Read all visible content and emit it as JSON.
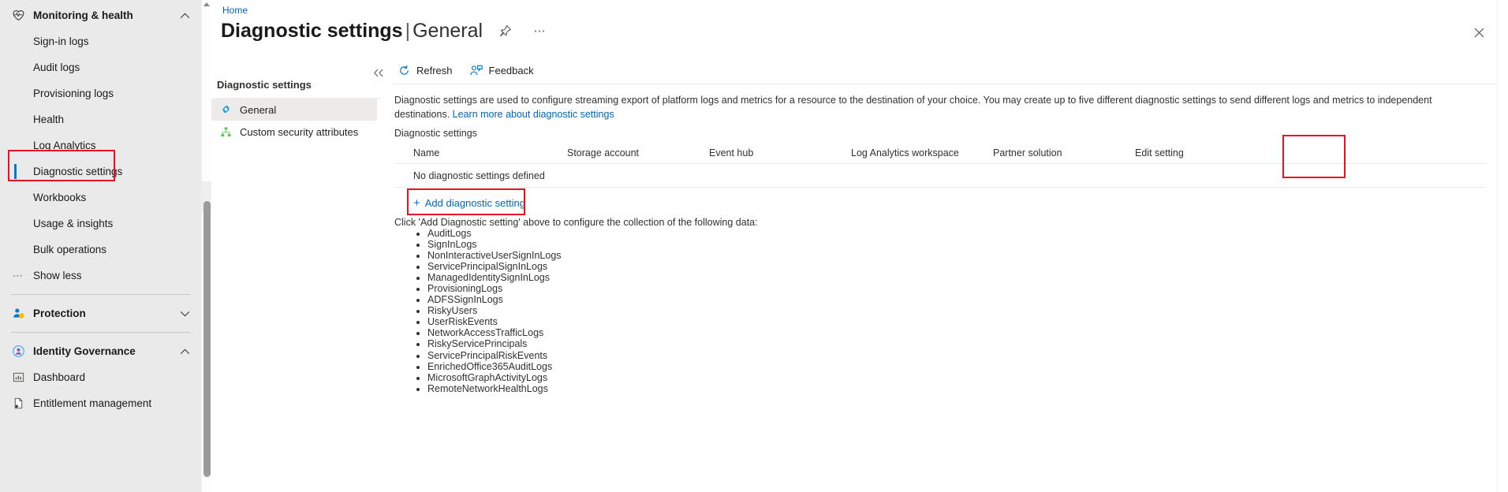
{
  "portal_nav": {
    "groups": [
      {
        "label": "Monitoring & health",
        "icon": "heart-pulse-icon",
        "chevron": "chevron-up-icon",
        "items": [
          {
            "label": "Sign-in logs",
            "icon": ""
          },
          {
            "label": "Audit logs",
            "icon": ""
          },
          {
            "label": "Provisioning logs",
            "icon": ""
          },
          {
            "label": "Health",
            "icon": ""
          },
          {
            "label": "Log Analytics",
            "icon": ""
          },
          {
            "label": "Diagnostic settings",
            "icon": "",
            "selected": true,
            "highlighted": true
          },
          {
            "label": "Workbooks",
            "icon": ""
          },
          {
            "label": "Usage & insights",
            "icon": ""
          },
          {
            "label": "Bulk operations",
            "icon": ""
          },
          {
            "label": "Show less",
            "icon": "ellipsis-icon"
          }
        ]
      },
      {
        "label": "Protection",
        "icon": "shield-person-icon",
        "chevron": "chevron-down-icon",
        "items": []
      },
      {
        "label": "Identity Governance",
        "icon": "identity-governance-icon",
        "chevron": "chevron-up-icon",
        "items": [
          {
            "label": "Dashboard",
            "icon": "dashboard-icon"
          },
          {
            "label": "Entitlement management",
            "icon": "document-icon"
          }
        ]
      }
    ]
  },
  "blade": {
    "breadcrumb": "Home",
    "title": "Diagnostic settings",
    "title_separator": "|",
    "title_sub": "General",
    "pin_icon": "pin-icon",
    "more_icon": "ellipsis-icon",
    "close_icon": "close-icon",
    "collapse_icon": "chevron-double-left-icon",
    "menu": {
      "title": "Diagnostic settings",
      "items": [
        {
          "label": "General",
          "icon": "gear-icon",
          "active": true
        },
        {
          "label": "Custom security attributes",
          "icon": "hierarchy-icon",
          "active": false
        }
      ]
    },
    "toolbar": {
      "refresh_label": "Refresh",
      "refresh_icon": "refresh-icon",
      "feedback_label": "Feedback",
      "feedback_icon": "feedback-person-icon"
    },
    "description": {
      "text": "Diagnostic settings are used to configure streaming export of platform logs and metrics for a resource to the destination of your choice. You may create up to five different diagnostic settings to send different logs and metrics to independent destinations.",
      "link_label": "Learn more about diagnostic settings"
    },
    "section_label": "Diagnostic settings",
    "table": {
      "columns": [
        "Name",
        "Storage account",
        "Event hub",
        "Log Analytics workspace",
        "Partner solution",
        "Edit setting"
      ],
      "empty_message": "No diagnostic settings defined"
    },
    "add_button": {
      "plus": "+",
      "label": "Add diagnostic setting"
    },
    "hint": "Click 'Add Diagnostic setting' above to configure the collection of the following data:",
    "log_categories": [
      "AuditLogs",
      "SignInLogs",
      "NonInteractiveUserSignInLogs",
      "ServicePrincipalSignInLogs",
      "ManagedIdentitySignInLogs",
      "ProvisioningLogs",
      "ADFSSignInLogs",
      "RiskyUsers",
      "UserRiskEvents",
      "NetworkAccessTrafficLogs",
      "RiskyServicePrincipals",
      "ServicePrincipalRiskEvents",
      "EnrichedOffice365AuditLogs",
      "MicrosoftGraphActivityLogs",
      "RemoteNetworkHealthLogs"
    ]
  },
  "colors": {
    "accent": "#0078d4",
    "link": "#0067b8",
    "highlight_red": "#e81123",
    "nav_bg": "#eaeaea"
  }
}
